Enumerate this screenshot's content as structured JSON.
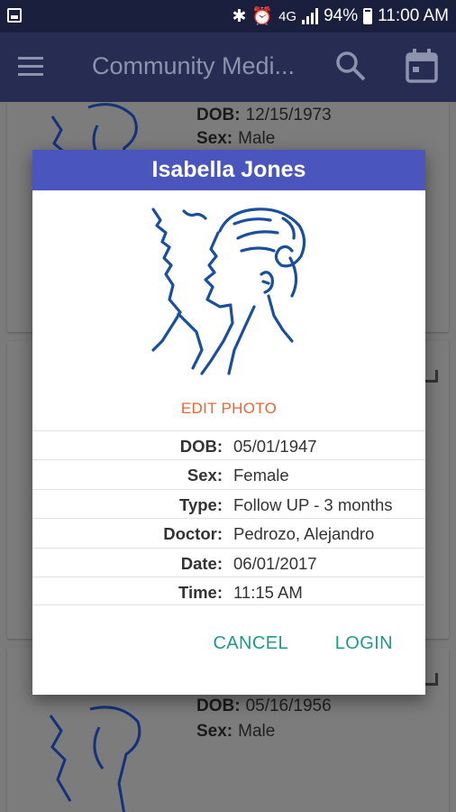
{
  "status_bar": {
    "battery_percent": "94%",
    "network": "4G",
    "time": "11:00 AM"
  },
  "app_bar": {
    "title": "Community Medi...",
    "icons": [
      "menu-icon",
      "search-icon",
      "calendar-icon"
    ]
  },
  "background_cards": [
    {
      "dob_label": "DOB:",
      "dob": "12/15/1973",
      "sex_label": "Sex:",
      "sex": "Male"
    },
    {
      "dob_label": "DOB:",
      "dob": "05/16/1956",
      "sex_label": "Sex:",
      "sex": "Male"
    }
  ],
  "dialog": {
    "title": "Isabella  Jones",
    "edit_photo": "EDIT PHOTO",
    "details": [
      {
        "label": "DOB:",
        "value": "05/01/1947"
      },
      {
        "label": "Sex:",
        "value": "Female"
      },
      {
        "label": "Type:",
        "value": "Follow UP - 3 months"
      },
      {
        "label": "Doctor:",
        "value": "Pedrozo, Alejandro"
      },
      {
        "label": "Date:",
        "value": "06/01/2017"
      },
      {
        "label": "Time:",
        "value": "11:15 AM"
      }
    ],
    "cancel_label": "CANCEL",
    "login_label": "LOGIN"
  },
  "colors": {
    "header_blue": "#4a56bd",
    "accent_orange": "#f2622e",
    "action_teal": "#1e9a89",
    "portrait_blue": "#1a4e9e"
  }
}
